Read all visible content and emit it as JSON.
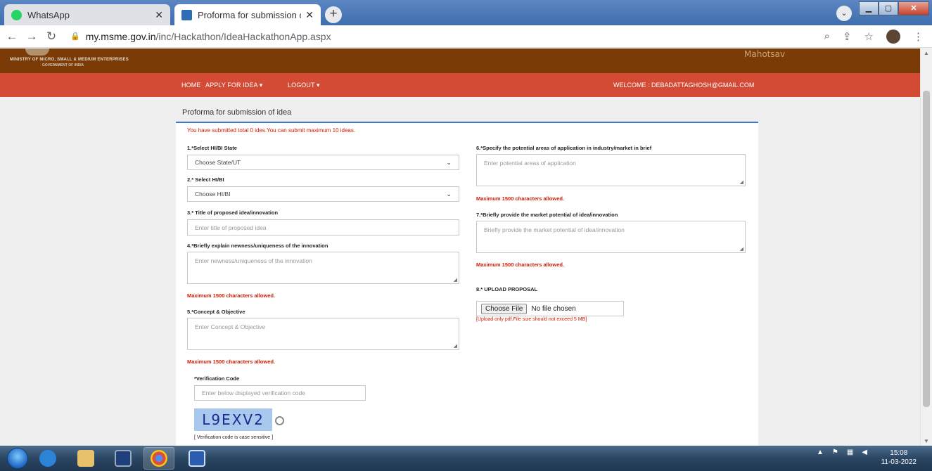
{
  "browser": {
    "tabs": [
      {
        "title": "WhatsApp",
        "active": false
      },
      {
        "title": "Proforma for submission of idea",
        "active": true
      }
    ],
    "url_host": "my.msme.gov.in",
    "url_path": "/inc/HackathonApp.aspx",
    "url_display_path": "/inc/Hackathon/IdeaHackathonApp.aspx"
  },
  "site": {
    "ministry": "MINISTRY OF MICRO, SMALL & MEDIUM ENTERPRISES",
    "government": "GOVERNMENT OF INDIA",
    "amrit": "Mahotsav",
    "menu": {
      "home": "HOME",
      "apply": "APPLY FOR IDEA ▾",
      "logout": "LOGOUT ▾",
      "welcome": "WELCOME : DEBADATTAGHOSH@GMAIL.COM"
    }
  },
  "form": {
    "title": "Proforma for submission of idea",
    "notice": "You have submitted total 0 ides.You can submit maximum 10 ideas.",
    "q1": {
      "label": "1.*Select HI/BI State",
      "value": "Choose State/UT"
    },
    "q2": {
      "label": "2.* Select HI/BI",
      "value": "Choose HI/BI"
    },
    "q3": {
      "label": "3.* Title of proposed idea/innovation",
      "placeholder": "Enter title of proposed idea"
    },
    "q4": {
      "label": "4.*Briefly explain newness/uniqueness of the innovation",
      "placeholder": "Enter newness/uniqueness of the innovation",
      "limit": "Maximum 1500 characters allowed."
    },
    "q5": {
      "label": "5.*Concept & Objective",
      "placeholder": "Enter Concept & Objective",
      "limit": "Maximum 1500 characters allowed."
    },
    "q6": {
      "label": "6.*Specify the potential areas of application in industry/market in brief",
      "placeholder": "Enter potential areas of application",
      "limit": "Maximum 1500 characters allowed."
    },
    "q7": {
      "label": "7.*Briefly provide the market potential of idea/innovation",
      "placeholder": "Briefly provide the market potential of idea/innovation",
      "limit": "Maximum 1500 characters allowed."
    },
    "q8": {
      "label": "8.* UPLOAD PROPOSAL",
      "button": "Choose File",
      "status": "No file chosen",
      "note": "[Upload only pdf.File size should not exceed 5 MB]"
    },
    "verification": {
      "label": "*Verification Code",
      "placeholder": "Enter below displayed verification code",
      "captcha": "L9EXV2",
      "note": "[ Verification code is case sensitive ]"
    }
  },
  "taskbar": {
    "time": "15:08",
    "date": "11-03-2022"
  },
  "colors": {
    "header": "#7b3b06",
    "menu": "#d34a35",
    "accent": "#3b7bc3",
    "error": "#d11a00"
  }
}
